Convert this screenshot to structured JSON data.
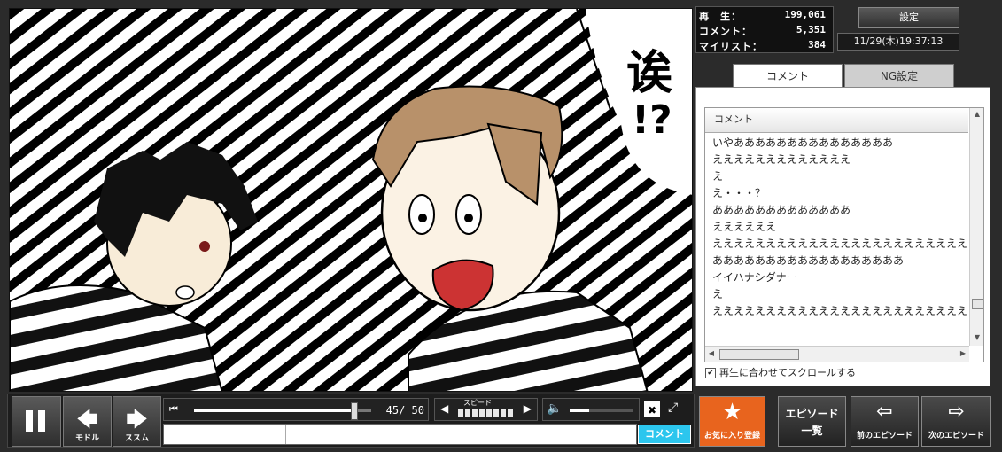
{
  "stats": {
    "views_label": "再　生：",
    "views": "199,061",
    "comments_label": "コメント：",
    "comments": "5,351",
    "mylist_label": "マイリスト：",
    "mylist": "384"
  },
  "settings_label": "設定",
  "clock": "11/29(木)19:37:13",
  "tabs": {
    "comment": "コメント",
    "ng": "NG設定"
  },
  "comment_list": {
    "header": "コメント",
    "items": [
      "いやあああああああああああああああ",
      "えええええええええええええ",
      "え",
      "え・・・？",
      "あああああああああああああ",
      "ええええええ",
      "ええええええええええええええええええええええええ",
      "ああああああああああああああああああ",
      "イイハナシダナー",
      "え",
      "ええええええええええええええええええええええええ"
    ]
  },
  "auto_scroll_label": "再生に合わせてスクロールする",
  "video": {
    "sfx_text": "诶",
    "sfx_marks": "!?"
  },
  "controls": {
    "back_label": "モドル",
    "forward_label": "ススム",
    "time": "45/ 50",
    "seek_fraction": 0.9,
    "speed_label": "スピード",
    "volume_fraction": 0.3,
    "comment_placeholder": "",
    "comment_submit": "コメント"
  },
  "buttons": {
    "favorite": "お気に入り登録",
    "episode_list_1": "エピソード",
    "episode_list_2": "一覧",
    "prev_episode": "前のエピソード",
    "next_episode": "次のエピソード"
  },
  "colors": {
    "favorite_bg": "#e8641e",
    "comment_submit_bg": "#2cc6ee"
  }
}
